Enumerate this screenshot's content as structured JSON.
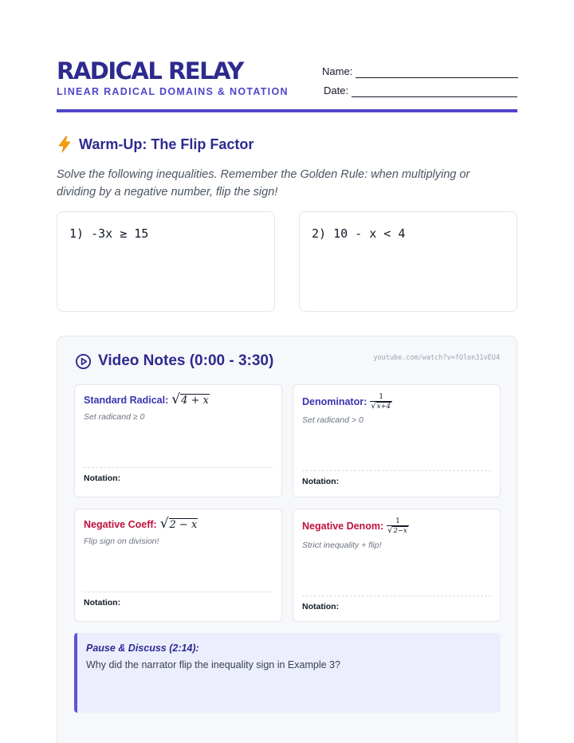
{
  "header": {
    "title": "RADICAL RELAY",
    "subtitle": "LINEAR RADICAL DOMAINS & NOTATION",
    "name_label": "Name:",
    "date_label": "Date:"
  },
  "warmup": {
    "icon": "lightning-bolt-icon",
    "title": "Warm-Up: The Flip Factor",
    "instructions": "Solve the following inequalities. Remember the Golden Rule: when multiplying or dividing by a negative number, flip the sign!",
    "problems": [
      {
        "text": "1) -3x ≥ 15"
      },
      {
        "text": "2) 10 - x < 4"
      }
    ]
  },
  "video": {
    "icon": "play-circle-icon",
    "title": "Video Notes (0:00 - 3:30)",
    "link": "youtube.com/watch?v=fOlon31vEU4",
    "cards": [
      {
        "title": "Standard Radical:",
        "math": "4 + x",
        "hint": "Set radicand ≥ 0",
        "notation_label": "Notation:"
      },
      {
        "title": "Denominator:",
        "math_num": "1",
        "math_den": "x+4",
        "hint": "Set radicand > 0",
        "notation_label": "Notation:"
      },
      {
        "title": "Negative Coeff:",
        "math": "2 − x",
        "hint": "Flip sign on division!",
        "notation_label": "Notation:"
      },
      {
        "title": "Negative Denom:",
        "math_num": "1",
        "math_den": "2−x",
        "hint": "Strict inequality + flip!",
        "notation_label": "Notation:"
      }
    ],
    "discuss": {
      "heading": "Pause & Discuss (2:14):",
      "question": "Why did the narrator flip the inequality sign in Example 3?"
    }
  },
  "colors": {
    "primary": "#2e2a8f",
    "accent": "#4f46c8",
    "warning": "#be123c",
    "bolt": "#f59e0b"
  }
}
